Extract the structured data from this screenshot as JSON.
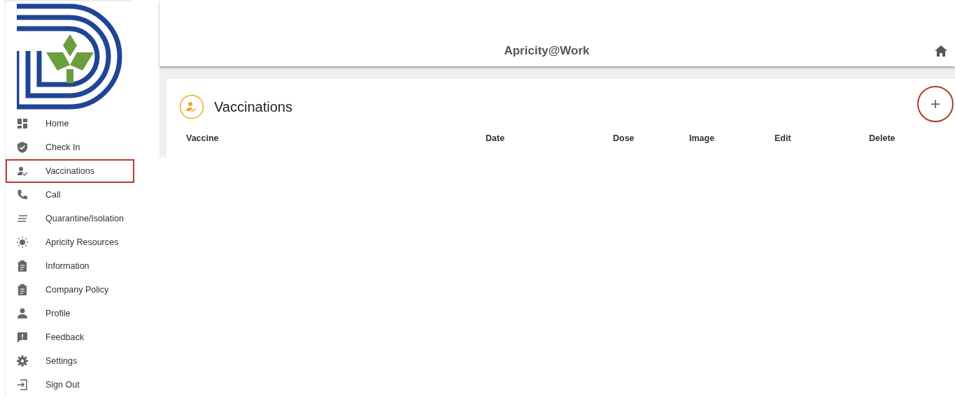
{
  "sidebar": {
    "items": [
      {
        "label": "Home",
        "selected": false
      },
      {
        "label": "Check In",
        "selected": false
      },
      {
        "label": "Vaccinations",
        "selected": true
      },
      {
        "label": "Call",
        "selected": false
      },
      {
        "label": "Quarantine/Isolation",
        "selected": false
      },
      {
        "label": "Apricity Resources",
        "selected": false
      },
      {
        "label": "Information",
        "selected": false
      },
      {
        "label": "Company Policy",
        "selected": false
      },
      {
        "label": "Profile",
        "selected": false
      },
      {
        "label": "Feedback",
        "selected": false
      },
      {
        "label": "Settings",
        "selected": false
      },
      {
        "label": "Sign Out",
        "selected": false
      }
    ]
  },
  "header": {
    "title": "Apricity@Work"
  },
  "card": {
    "title": "Vaccinations",
    "add_button": {
      "label": "+",
      "highlighted": true
    },
    "table": {
      "columns": [
        "Vaccine",
        "Date",
        "Dose",
        "Image",
        "Edit",
        "Delete"
      ]
    }
  }
}
